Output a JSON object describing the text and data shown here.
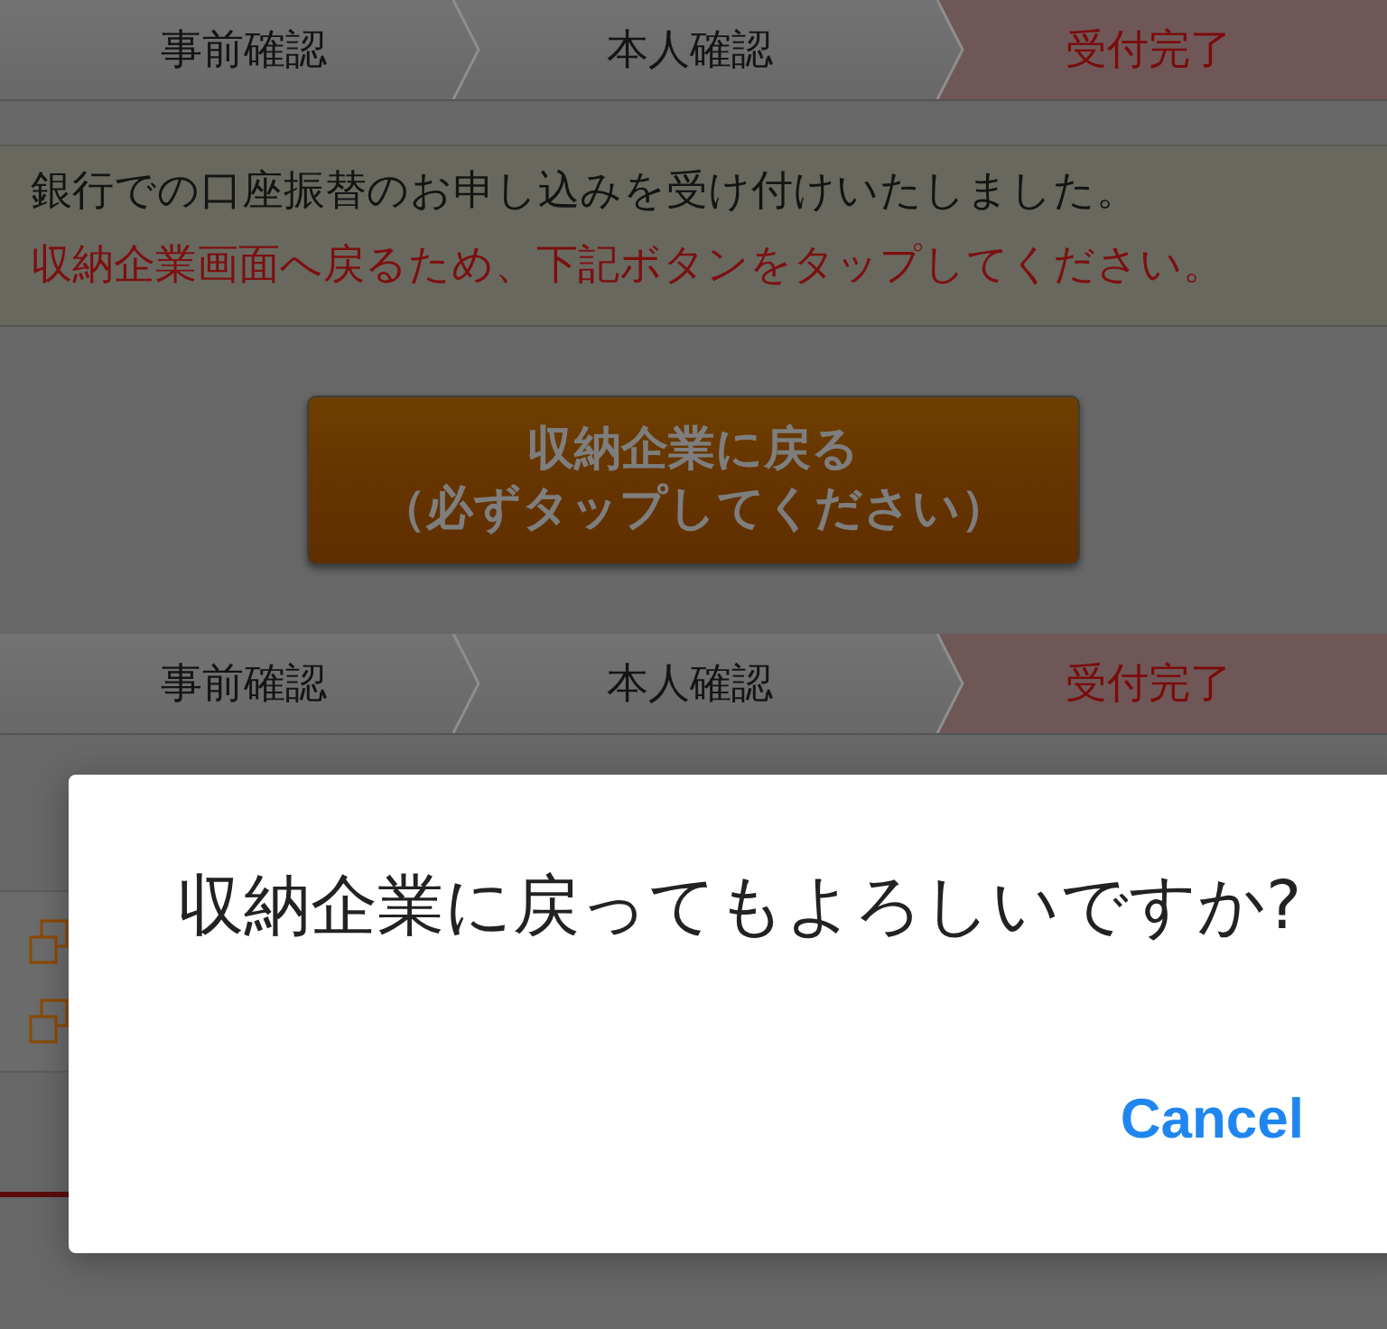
{
  "progress_steps_top": [
    {
      "label": "事前確認",
      "selected": false
    },
    {
      "label": "本人確認",
      "selected": false
    },
    {
      "label": "受付完了",
      "selected": true
    }
  ],
  "notice": {
    "lines": [
      {
        "text": "銀行での口座振替のお申し込みを受け付けいたしました。",
        "kind": "info"
      },
      {
        "text": "収納企業画面へ戻るため、下記ボタンをタップしてください。",
        "kind": "alert"
      }
    ]
  },
  "return_button": {
    "lines": [
      "収納企業に戻る",
      "（必ずタップしてください）"
    ]
  },
  "progress_steps_bottom": [
    {
      "label": "事前確認",
      "selected": false
    },
    {
      "label": "本人確認",
      "selected": false
    },
    {
      "label": "受付完了",
      "selected": true
    }
  ],
  "dialog": {
    "message": "収納企業に戻ってもよろしいですか?",
    "buttons": [
      "Cancel"
    ]
  }
}
